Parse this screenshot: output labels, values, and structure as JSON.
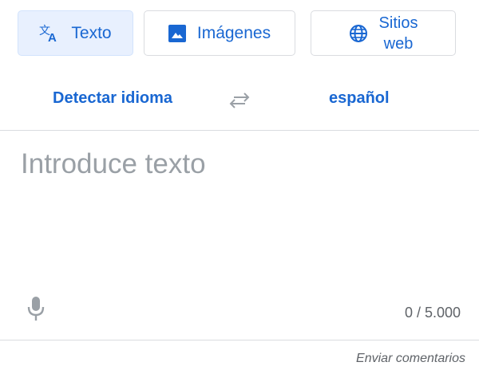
{
  "tabs": {
    "text_label": "Texto",
    "images_label": "Imágenes",
    "sites_label_line1": "Sitios",
    "sites_label_line2": "web",
    "active": "Texto"
  },
  "languages": {
    "source": "Detectar idioma",
    "target": "español"
  },
  "input": {
    "placeholder": "Introduce texto",
    "value": "",
    "char_count": "0 / 5.000"
  },
  "footer": {
    "feedback_label": "Enviar comentarios"
  },
  "colors": {
    "accent": "#1967d2",
    "active_tab_bg": "#e8f0fe",
    "divider": "#dadce0",
    "muted": "#9aa0a6"
  },
  "icons": {
    "text_tab": "translate-icon",
    "images_tab": "image-icon",
    "sites_tab": "globe-icon",
    "swap": "swap-languages-icon",
    "mic": "microphone-icon"
  }
}
